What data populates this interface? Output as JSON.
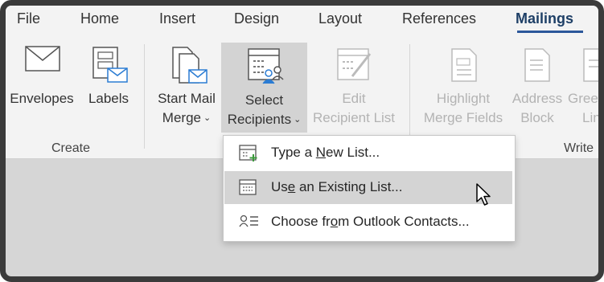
{
  "tabs": [
    {
      "label": "File"
    },
    {
      "label": "Home"
    },
    {
      "label": "Insert"
    },
    {
      "label": "Design"
    },
    {
      "label": "Layout"
    },
    {
      "label": "References"
    },
    {
      "label": "Mailings",
      "active": true
    }
  ],
  "ribbon": {
    "groups": [
      {
        "label": "Create"
      },
      {
        "label": "Write"
      }
    ],
    "buttons": {
      "envelopes": {
        "label": "Envelopes",
        "icon": "envelope-icon"
      },
      "labels": {
        "label": "Labels",
        "icon": "labels-icon"
      },
      "start_mail_merge": {
        "line1": "Start Mail",
        "line2": "Merge",
        "icon": "start-mail-merge-icon"
      },
      "select_recipients": {
        "line1": "Select",
        "line2": "Recipients",
        "icon": "select-recipients-icon"
      },
      "edit_recipient_list": {
        "line1": "Edit",
        "line2": "Recipient List",
        "icon": "edit-recipient-list-icon",
        "disabled": true
      },
      "highlight_merge_fields": {
        "line1": "Highlight",
        "line2": "Merge Fields",
        "icon": "highlight-merge-fields-icon",
        "disabled": true
      },
      "address_block": {
        "line1": "Address",
        "line2": "Block",
        "icon": "address-block-icon",
        "disabled": true
      },
      "greeting_line": {
        "line1": "Greeti",
        "line2": "Lin",
        "icon": "greeting-line-icon",
        "disabled": true
      }
    }
  },
  "dropdown": {
    "items": [
      {
        "pre": "Type a ",
        "key": "N",
        "post": "ew List...",
        "icon": "new-list-icon"
      },
      {
        "pre": "Us",
        "key": "e",
        "post": " an Existing List...",
        "icon": "existing-list-icon",
        "hover": true
      },
      {
        "pre": "Choose fr",
        "key": "o",
        "post": "m Outlook Contacts...",
        "icon": "outlook-contacts-icon"
      }
    ]
  },
  "colors": {
    "accent": "#2b579a",
    "ribbon_bg": "#f3f3f3",
    "pressed_bg": "#d3d3d3",
    "document_bg": "#d6d6d6",
    "disabled_text": "#b3b3b3"
  }
}
